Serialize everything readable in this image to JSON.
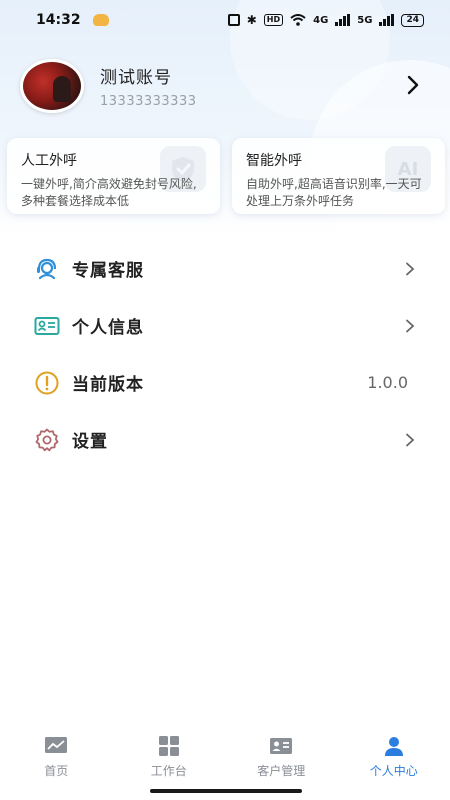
{
  "status_bar": {
    "time": "14:32",
    "network_a": "4G",
    "network_b": "5G",
    "battery": "24",
    "hd": "HD"
  },
  "profile": {
    "name": "测试账号",
    "phone": "13333333333"
  },
  "service_cards": [
    {
      "title": "人工外呼",
      "description": "一键外呼,简介高效避免封号风险,多种套餐选择成本低"
    },
    {
      "title": "智能外呼",
      "description": "自助外呼,超高语音识别率,一天可处理上万条外呼任务",
      "deco_text": "AI"
    }
  ],
  "menu": {
    "items": [
      {
        "label": "专属客服",
        "icon": "headset-icon",
        "value": ""
      },
      {
        "label": "个人信息",
        "icon": "id-card-icon",
        "value": ""
      },
      {
        "label": "当前版本",
        "icon": "info-alert-icon",
        "value": "1.0.0"
      },
      {
        "label": "设置",
        "icon": "gear-icon",
        "value": ""
      }
    ]
  },
  "tabbar": {
    "items": [
      {
        "label": "首页",
        "icon": "chart-icon"
      },
      {
        "label": "工作台",
        "icon": "grid-icon"
      },
      {
        "label": "客户管理",
        "icon": "contacts-icon"
      },
      {
        "label": "个人中心",
        "icon": "person-icon"
      }
    ],
    "active_index": 3
  },
  "colors": {
    "accent": "#2b7de0",
    "inactive": "#8a8f96",
    "service_icon": "#2f8fd8",
    "info_icon": "#e0a020",
    "settings_icon": "#b0696a",
    "id_icon": "#29a9a0"
  }
}
